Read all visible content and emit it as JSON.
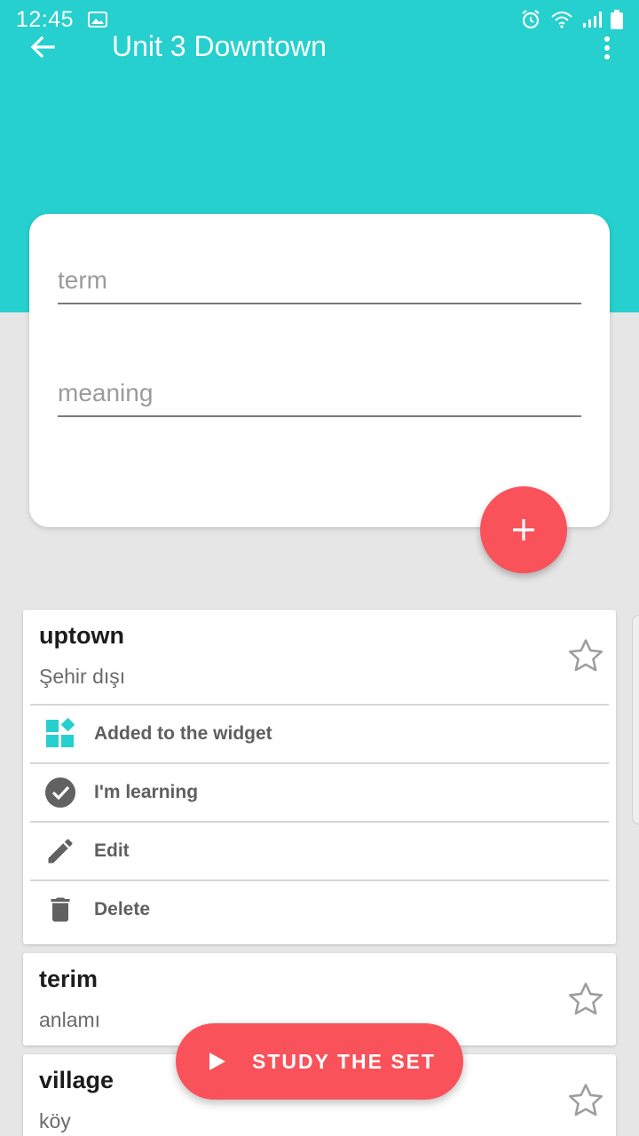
{
  "status_bar": {
    "time": "12:45",
    "left_icons": [
      "image-icon"
    ],
    "right_icons": [
      "alarm-icon",
      "wifi-icon",
      "signal-icon",
      "battery-icon"
    ]
  },
  "app_bar": {
    "title": "Unit 3 Downtown",
    "back_icon": "arrow-back-icon",
    "menu_icon": "more-vert-icon"
  },
  "form": {
    "term_placeholder": "term",
    "meaning_placeholder": "meaning",
    "add_icon": "plus-icon"
  },
  "cards": [
    {
      "term": "uptown",
      "meaning": "Şehir dışı",
      "expanded": true,
      "actions": [
        {
          "label": "Added to the widget",
          "icon": "widget-icon"
        },
        {
          "label": "I'm learning",
          "icon": "check-circle-icon"
        },
        {
          "label": "Edit",
          "icon": "pencil-icon"
        },
        {
          "label": "Delete",
          "icon": "trash-icon"
        }
      ]
    },
    {
      "term": "terim",
      "meaning": "anlamı",
      "expanded": false
    },
    {
      "term": "village",
      "meaning": "köy",
      "expanded": false
    }
  ],
  "study_button": {
    "label": "STUDY THE SET",
    "icon": "play-icon"
  },
  "colors": {
    "primary": "#26d0ce",
    "accent": "#f9525a",
    "background": "#e6e6e6"
  }
}
